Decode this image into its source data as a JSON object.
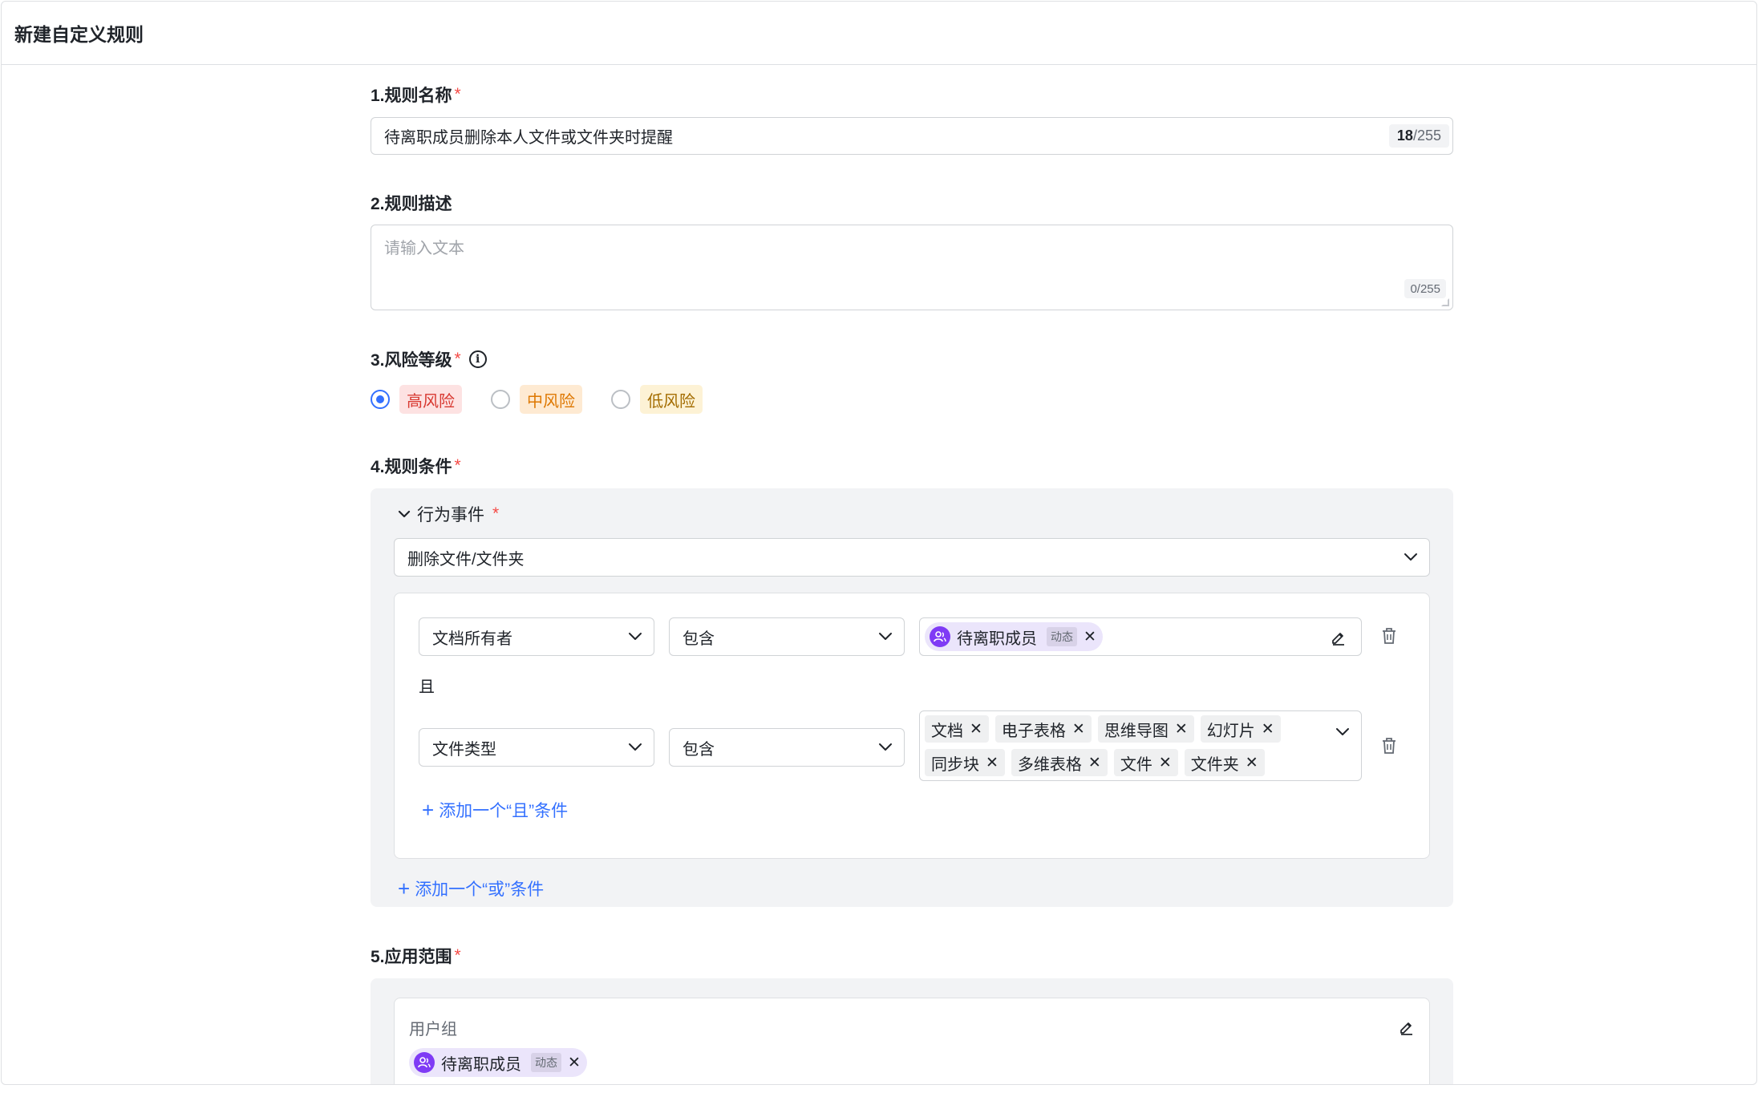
{
  "page": {
    "title": "新建自定义规则"
  },
  "fields": {
    "name": {
      "label": "1.规则名称",
      "value": "待离职成员删除本人文件或文件夹时提醒",
      "count": "18",
      "max": "/255"
    },
    "description": {
      "label": "2.规则描述",
      "placeholder": "请输入文本",
      "counter": "0/255"
    },
    "risk": {
      "label": "3.风险等级",
      "options": [
        {
          "label": "高风险",
          "checked": true
        },
        {
          "label": "中风险",
          "checked": false
        },
        {
          "label": "低风险",
          "checked": false
        }
      ]
    },
    "conditions": {
      "label": "4.规则条件",
      "event_label": "行为事件",
      "event_value": "删除文件/文件夹",
      "rows": [
        {
          "field": "文档所有者",
          "operator": "包含",
          "user_tag": "待离职成员",
          "dynamic": "动态"
        },
        {
          "field": "文件类型",
          "operator": "包含",
          "file_types": [
            "文档",
            "电子表格",
            "思维导图",
            "幻灯片",
            "同步块",
            "多维表格",
            "文件",
            "文件夹"
          ]
        }
      ],
      "and_label": "且",
      "add_and": "添加一个“且”条件",
      "add_or": "添加一个“或”条件"
    },
    "scope": {
      "label": "5.应用范围",
      "group_label": "用户组",
      "user_tag": "待离职成员",
      "dynamic": "动态"
    }
  },
  "required_mark": "*",
  "close_glyph": "✕",
  "info_glyph": "i",
  "accent_color": "#3370ff"
}
